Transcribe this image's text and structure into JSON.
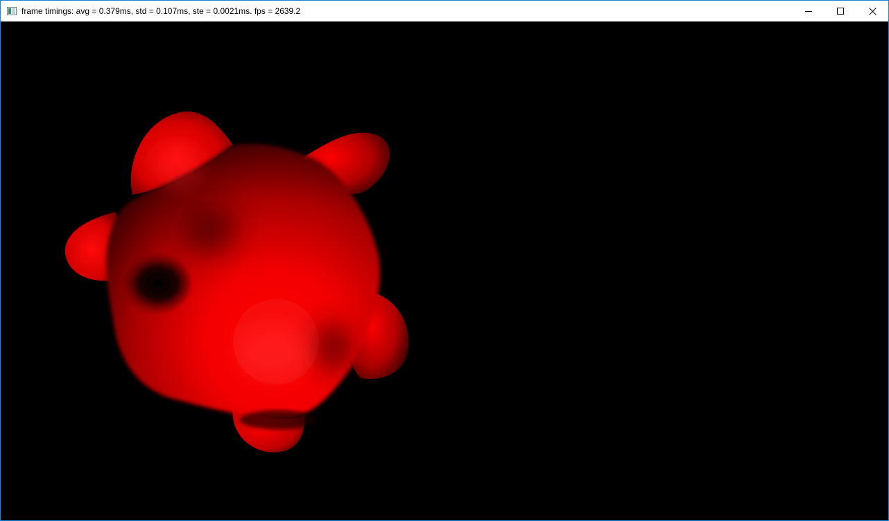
{
  "window": {
    "title": "frame timings: avg = 0.379ms, std = 0.107ms, ste = 0.0021ms. fps = 2639.2",
    "controls": {
      "minimize_icon": "minimize-icon",
      "maximize_icon": "maximize-icon",
      "close_icon": "close-icon"
    }
  },
  "scene": {
    "background_color": "#000000",
    "object_color": "#ff0000",
    "object": "red-blob-metaball"
  }
}
